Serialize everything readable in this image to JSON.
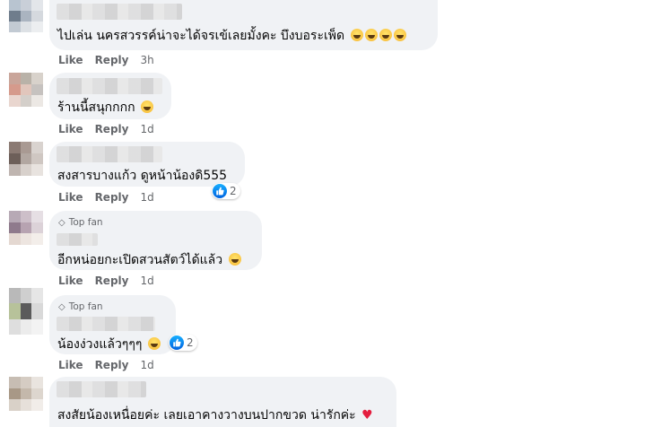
{
  "actions": {
    "like": "Like",
    "reply": "Reply"
  },
  "badge_label": "Top fan",
  "comments": [
    {
      "text": "ไปเล่น นครสวรรค์น่าจะได้จรเข้เลยมั้งคะ บึงบอระเพ็ด",
      "time": "3h"
    },
    {
      "text": "ร้านนี้สนุกกกก",
      "time": "1d"
    },
    {
      "text": "สงสารบางแก้ว ดูหน้าน้องดิ555",
      "time": "1d",
      "reaction_count": "2"
    },
    {
      "text": "อีกหน่อยกะเปิดสวนสัตว์ได้แล้ว",
      "time": "1d"
    },
    {
      "text": "น้องง่วงแล้วๆๆๆ",
      "time": "1d",
      "reaction_count": "2"
    },
    {
      "text": "สงสัยน้องเหนื่อยค่ะ เลยเอาคางวางบนปากขวด น่ารักค่ะ"
    }
  ],
  "colors": {
    "bubble": "#f0f2f5",
    "meta": "#65676b",
    "like_blue": "#1877f2",
    "heart": "#e41e3f"
  },
  "icons": [
    "thumbs-up-icon",
    "diamond-icon",
    "laugh-emoji-icon",
    "heart-icon"
  ]
}
